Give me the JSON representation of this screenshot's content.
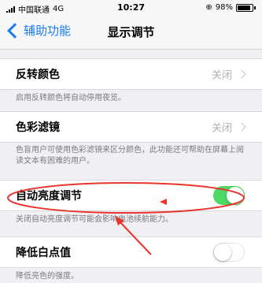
{
  "status_bar": {
    "carrier": "中国联通",
    "network": "4G",
    "time": "10:27",
    "battery": "98%",
    "battery_percent": 98
  },
  "nav": {
    "back_label": "辅助功能",
    "title": "显示调节"
  },
  "rows": [
    {
      "label": "反转颜色",
      "value": "关闭",
      "footer": "启用反转颜色将自动停用夜览。"
    },
    {
      "label": "色彩滤镜",
      "value": "关闭",
      "footer": "色盲用户可使用色彩滤镜来区分颜色，此功能还可帮助在屏幕上阅读文本有困难的用户。"
    },
    {
      "label": "自动亮度调节",
      "enabled": true,
      "footer": "关闭自动亮度调节可能会影响电池续航能力。"
    },
    {
      "label": "降低白点值",
      "enabled": false,
      "footer": "降低亮色的强度。"
    }
  ],
  "colors": {
    "accent": "#1a7cf5",
    "switch_on": "#4cd964",
    "annotation": "#e8352e"
  }
}
